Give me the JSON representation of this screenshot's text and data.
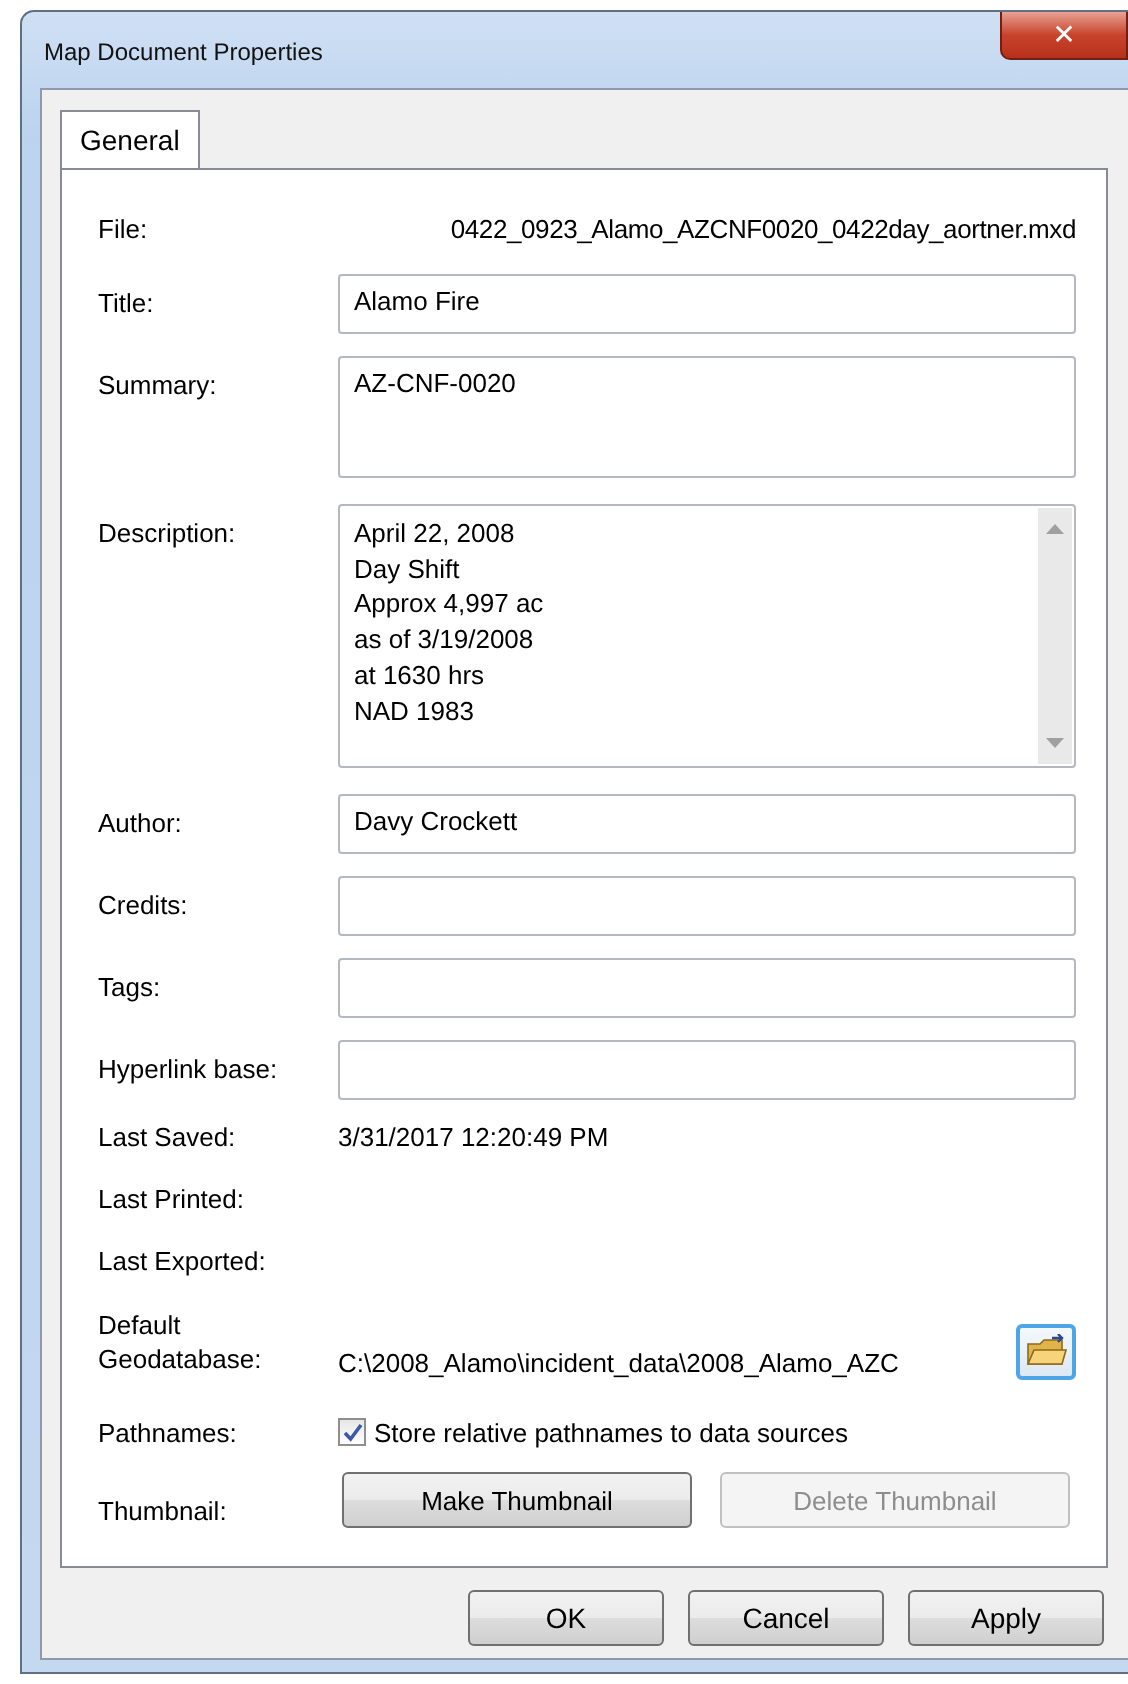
{
  "window": {
    "title": "Map Document Properties",
    "close": "✕"
  },
  "tabs": [
    {
      "label": "General",
      "selected": true
    }
  ],
  "rows": [
    {
      "kind": "text",
      "label": "File:",
      "value": "0422_0923_Alamo_AZCNF0020_0422day_aortner.mxd"
    },
    {
      "kind": "input",
      "label": "Title:",
      "value": "Alamo Fire"
    },
    {
      "kind": "memo",
      "label": "Summary:",
      "value": "AZ-CNF-0020"
    },
    {
      "kind": "scroll_memo",
      "label": "Description:",
      "lines": [
        "April 22, 2008",
        "Day Shift",
        "Approx 4,997 ac",
        "as of 3/19/2008",
        "at 1630 hrs",
        "NAD 1983"
      ]
    },
    {
      "kind": "input",
      "label": "Author:",
      "value": "Davy Crockett"
    },
    {
      "kind": "input",
      "label": "Credits:"
    },
    {
      "kind": "input",
      "label": "Tags:"
    },
    {
      "kind": "input",
      "label": "Hyperlink base:"
    },
    {
      "kind": "info",
      "label": "Last Saved:",
      "value": "3/31/2017 12:20:49 PM"
    },
    {
      "kind": "info",
      "label": "Last Printed:"
    },
    {
      "kind": "info",
      "label": "Last Exported:"
    },
    {
      "kind": "path",
      "label": "Default Geodatabase:",
      "value": "C:\\2008_Alamo\\incident_data\\2008_Alamo_AZC"
    },
    {
      "kind": "checkbox",
      "label": "Pathnames:",
      "text": "Store relative pathnames to data sources",
      "checked": true
    },
    {
      "kind": "buttons",
      "label": "Thumbnail:",
      "buttons": [
        {
          "label": "Make Thumbnail",
          "disabled": false
        },
        {
          "label": "Delete Thumbnail",
          "disabled": true
        }
      ]
    }
  ],
  "buttons": [
    "OK",
    "Cancel",
    "Apply"
  ]
}
